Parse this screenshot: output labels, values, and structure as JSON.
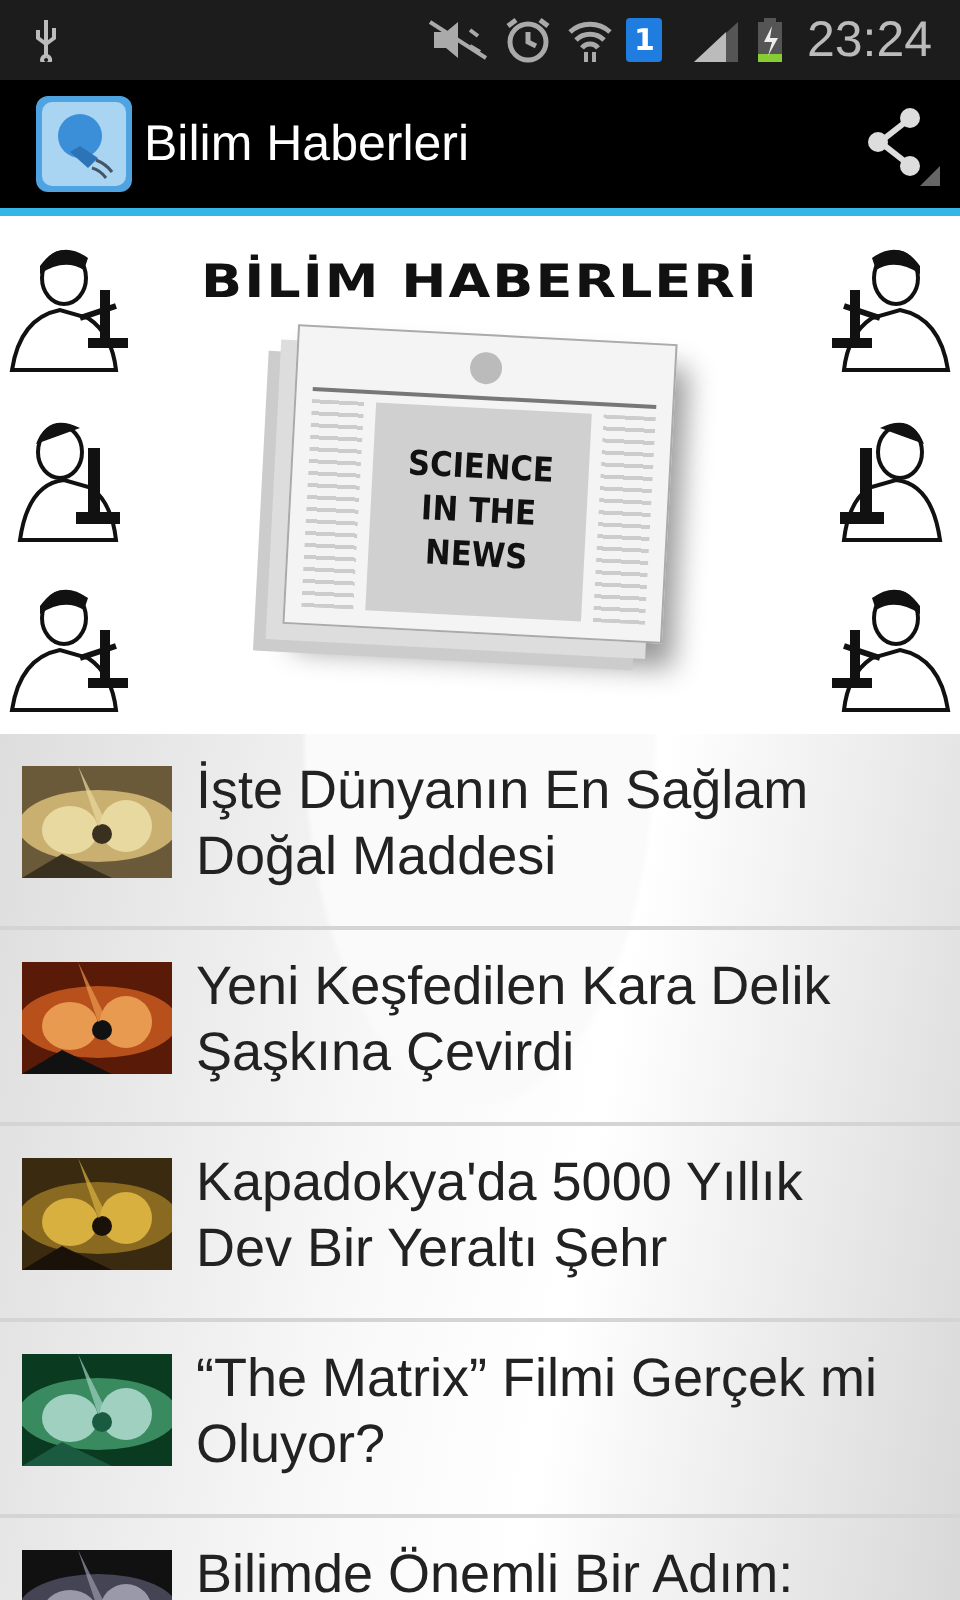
{
  "status_bar": {
    "sim_badge": "1",
    "time": "23:24"
  },
  "action_bar": {
    "title": "Bilim Haberleri"
  },
  "banner": {
    "heading": "BİLİM HABERLERİ",
    "paper_lines": [
      "SCIENCE",
      "IN THE",
      "NEWS"
    ]
  },
  "articles": [
    {
      "title": "İşte Dünyanın En Sağlam Doğal Maddesi",
      "kind": "picture"
    },
    {
      "title": "Yeni Keşfedilen Kara Delik Şaşkına Çevirdi",
      "kind": "picture"
    },
    {
      "title": "Kapadokya'da 5000 Yıllık Dev Bir Yeraltı Şehr",
      "kind": "picture"
    },
    {
      "title": "“The Matrix” Filmi Gerçek mi Oluyor?",
      "kind": "picture"
    },
    {
      "title": "Bilimde Önemli Bir Adım:",
      "kind": "picture"
    }
  ]
}
